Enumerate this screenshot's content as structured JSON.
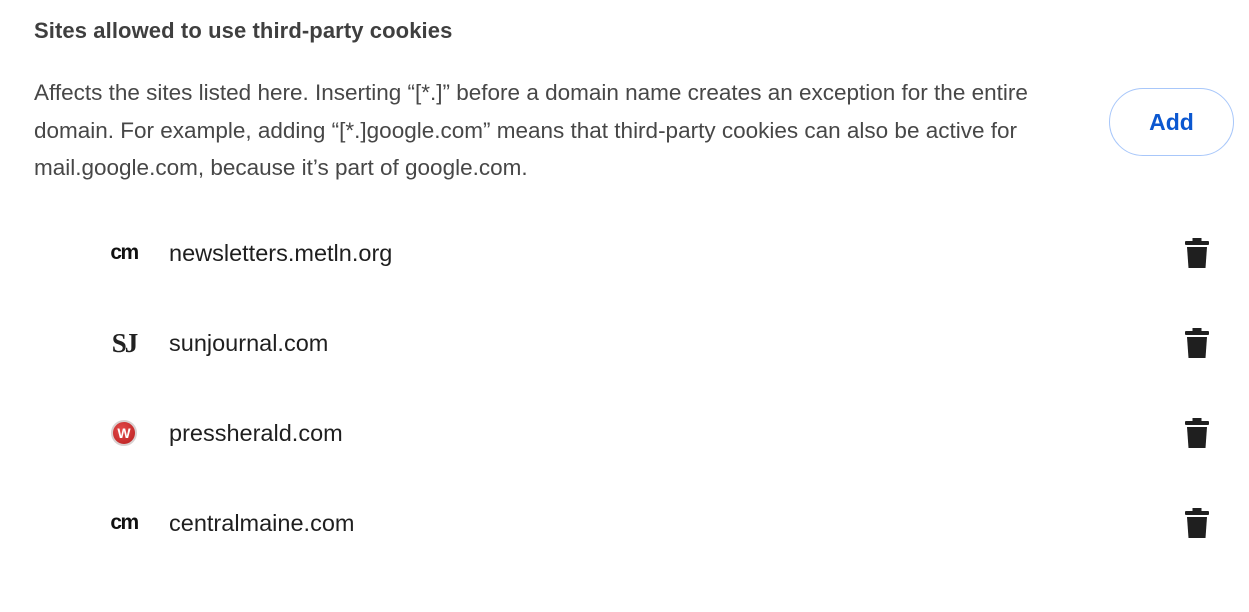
{
  "section": {
    "title": "Sites allowed to use third-party cookies",
    "description": "Affects the sites listed here. Inserting “[*.]” before a domain name creates an exception for the entire domain. For example, adding “[*.]google.com” means that third-party cookies can also be active for mail.google.com, because it’s part of google.com.",
    "add_label": "Add"
  },
  "sites": [
    {
      "name": "newsletters.metln.org",
      "favicon_text": "cm",
      "favicon_icon": "cm-favicon-icon",
      "delete_icon": "trash-icon"
    },
    {
      "name": "sunjournal.com",
      "favicon_text": "SJ",
      "favicon_icon": "sj-favicon-icon",
      "delete_icon": "trash-icon"
    },
    {
      "name": "pressherald.com",
      "favicon_text": "W",
      "favicon_icon": "pressherald-favicon-icon",
      "delete_icon": "trash-icon"
    },
    {
      "name": "centralmaine.com",
      "favicon_text": "cm",
      "favicon_icon": "cm-favicon-icon",
      "delete_icon": "trash-icon"
    }
  ],
  "colors": {
    "accent": "#0b57d0",
    "button_border": "#a8c7fa",
    "icon": "#1f1f1f",
    "pressherald_red": "#c62828"
  }
}
